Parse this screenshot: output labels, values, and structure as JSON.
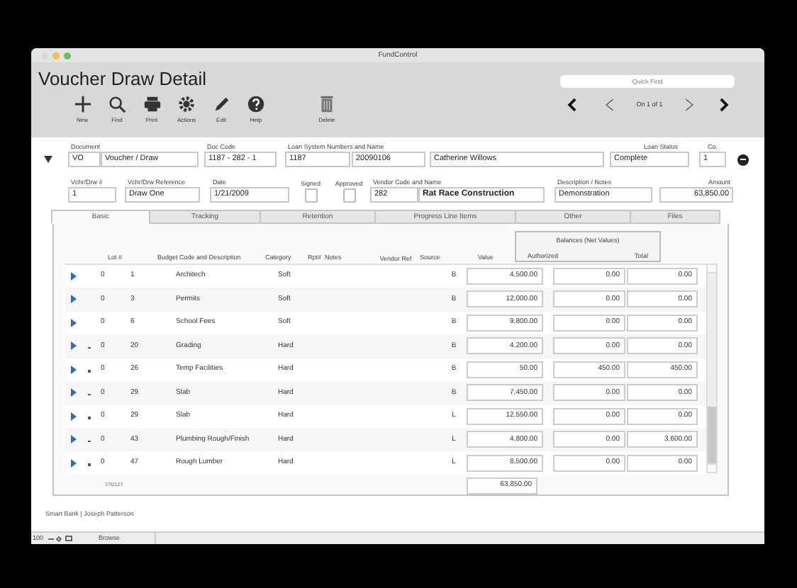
{
  "window": {
    "title": "FundControl"
  },
  "page_title": "Voucher Draw Detail",
  "quick_find": {
    "placeholder": "Quick Find"
  },
  "toolbar": [
    {
      "label": "New",
      "kind": "new"
    },
    {
      "label": "Find",
      "kind": "find"
    },
    {
      "label": "Print",
      "kind": "print"
    },
    {
      "label": "Actions",
      "kind": "actions"
    },
    {
      "label": "Edit",
      "kind": "edit"
    },
    {
      "label": "Help",
      "kind": "help"
    },
    {
      "label": "Delete",
      "kind": "delete"
    }
  ],
  "record_nav": {
    "position": "On 1 of 1"
  },
  "header_fields": [
    {
      "label": "Document",
      "values": [
        "VO",
        "Voucher / Draw"
      ]
    },
    {
      "label": "Doc Code",
      "values": [
        "1187 - 282 - 1"
      ]
    },
    {
      "label": "Loan System Numbers and Name",
      "values": [
        "1187",
        "20090106",
        "Catherine Willows"
      ]
    },
    {
      "label": "Loan Status",
      "values": [
        "Complete"
      ]
    },
    {
      "label": "Co.",
      "values": [
        "1"
      ]
    }
  ],
  "draw_fields": [
    {
      "kind": "text",
      "label": "Vchr/Drw #",
      "values": [
        "1"
      ]
    },
    {
      "kind": "text",
      "label": "Vchr/Drw Reference",
      "values": [
        "Draw One"
      ]
    },
    {
      "kind": "text",
      "label": "Date",
      "values": [
        "1/21/2009"
      ]
    },
    {
      "kind": "checkbox",
      "label": "Signed",
      "checked": false
    },
    {
      "kind": "checkbox",
      "label": "Approved",
      "checked": false
    },
    {
      "kind": "text",
      "label": "Vendor Code and Name",
      "values": [
        "282",
        "Rat Race Construction"
      ]
    },
    {
      "kind": "text",
      "label": "Description / Notes",
      "values": [
        "Demonstration"
      ]
    },
    {
      "kind": "amount",
      "label": "Amount",
      "values": [
        "63,850.00"
      ]
    }
  ],
  "tabs": [
    {
      "label": "Basic",
      "selected": true
    },
    {
      "label": "Tracking",
      "selected": false
    },
    {
      "label": "Retention",
      "selected": false
    },
    {
      "label": "Progress Line Items",
      "selected": false
    },
    {
      "label": "Other",
      "selected": false
    },
    {
      "label": "Files",
      "selected": false
    }
  ],
  "table": {
    "columns": [
      "Lot #",
      "Budget Code and Description",
      "Category",
      "Rpt#",
      "Notes",
      "Vendor Ref",
      "Source",
      "Value"
    ],
    "balances": {
      "title": "Balances (Net Values)",
      "columns": [
        "Authorized",
        "Total"
      ]
    },
    "rows": [
      {
        "flagged": false,
        "lot": "0",
        "code": "1",
        "description": "Architech",
        "category": "Soft",
        "source": "B",
        "value": "4,500.00",
        "authorized": "0.00",
        "total": "0.00"
      },
      {
        "flagged": false,
        "lot": "0",
        "code": "3",
        "description": "Permits",
        "category": "Soft",
        "source": "B",
        "value": "12,000.00",
        "authorized": "0.00",
        "total": "0.00"
      },
      {
        "flagged": false,
        "lot": "0",
        "code": "6",
        "description": "School Fees",
        "category": "Soft",
        "source": "B",
        "value": "9,800.00",
        "authorized": "0.00",
        "total": "0.00"
      },
      {
        "flagged": true,
        "lot": "0",
        "code": "20",
        "description": "Grading",
        "category": "Hard",
        "source": "B",
        "value": "4,200.00",
        "authorized": "0.00",
        "total": "0.00"
      },
      {
        "flagged": true,
        "lot": "0",
        "code": "26",
        "description": "Temp Facilities",
        "category": "Hard",
        "source": "B",
        "value": "50.00",
        "authorized": "450.00",
        "total": "450.00"
      },
      {
        "flagged": true,
        "lot": "0",
        "code": "29",
        "description": "Slab",
        "category": "Hard",
        "source": "B",
        "value": "7,450.00",
        "authorized": "0.00",
        "total": "0.00"
      },
      {
        "flagged": true,
        "lot": "0",
        "code": "29",
        "description": "Slab",
        "category": "Hard",
        "source": "L",
        "value": "12,550.00",
        "authorized": "0.00",
        "total": "0.00"
      },
      {
        "flagged": true,
        "lot": "0",
        "code": "43",
        "description": "Plumbing Rough/Finish",
        "category": "Hard",
        "source": "L",
        "value": "4,800.00",
        "authorized": "0.00",
        "total": "3,600.00"
      },
      {
        "flagged": true,
        "lot": "0",
        "code": "47",
        "description": "Rough Lumber",
        "category": "Hard",
        "source": "L",
        "value": "8,500.00",
        "authorized": "0.00",
        "total": "0.00"
      }
    ],
    "counter": "176/127",
    "total": "63,850.00"
  },
  "footer": "Smart Bank | Joseph Patterson",
  "status_bar": {
    "zoom": "100",
    "mode": "Browse"
  }
}
